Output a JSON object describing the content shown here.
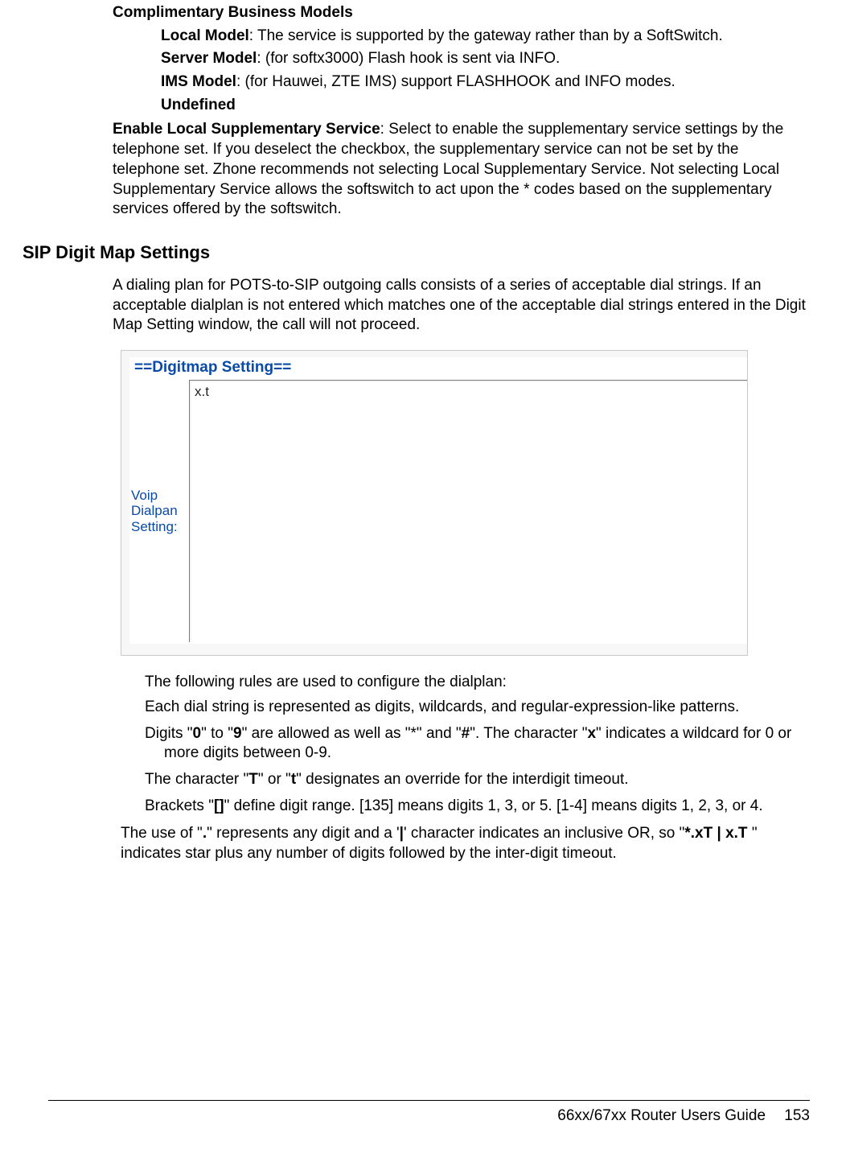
{
  "section1": {
    "heading": "Complimentary Business Models",
    "items": [
      {
        "label": "Local Model",
        "desc": ": The service is supported by the gateway rather than by a SoftSwitch."
      },
      {
        "label": "Server Model",
        "desc": ": (for softx3000) Flash hook is sent via INFO."
      },
      {
        "label": "IMS Model",
        "desc": ": (for Hauwei, ZTE IMS) support FLASHHOOK and INFO modes."
      },
      {
        "label": "Undefined",
        "desc": ""
      }
    ],
    "enable": {
      "label": "Enable Local Supplementary Service",
      "desc": ": Select to enable the supplementary service settings by the telephone set. If you deselect the checkbox, the supplementary service can not be set by the telephone set. Zhone recommends not selecting Local Supplementary Service. Not selecting Local Supplementary Service allows the softswitch to act upon the * codes based on the supplementary services offered by the softswitch."
    }
  },
  "section2": {
    "heading": "SIP Digit Map Settings",
    "intro": "A dialing plan for POTS-to-SIP outgoing calls consists of a series of acceptable dial strings. If an acceptable dialplan is not entered which matches one of the acceptable dial strings entered in the Digit Map Setting window, the call will not proceed.",
    "screenshot": {
      "title": "==Digitmap Setting==",
      "label_line1": "Voip",
      "label_line2": "Dialpan",
      "label_line3": "Setting:",
      "textarea_value": "x.t"
    },
    "rules_intro": "The following rules are used to configure the dialplan:",
    "rules": {
      "r1": "Each dial string is represented as digits, wildcards, and regular-expression-like patterns.",
      "r2_pre": "Digits \"",
      "r2_b1": "0",
      "r2_mid1": "\" to \"",
      "r2_b2": "9",
      "r2_mid2": "\" are allowed as well as \"*\" and \"",
      "r2_b3": "#",
      "r2_mid3": "\". The character \"",
      "r2_b4": "x",
      "r2_post": "\" indicates a wildcard for 0 or more digits between 0-9.",
      "r3_pre": "The character \"",
      "r3_b1": "T",
      "r3_mid": "\" or \"",
      "r3_b2": "t",
      "r3_post": "\" designates an override for the interdigit timeout.",
      "r4_pre": "Brackets \"",
      "r4_b1": "[]",
      "r4_post": "\" define digit range. [135] means digits 1, 3, or 5. [1-4] means digits 1, 2, 3, or 4."
    },
    "closing_pre": "The use of \"",
    "closing_b1": ".",
    "closing_mid1": "\" represents any digit and a '",
    "closing_b2": "|",
    "closing_mid2": "' character indicates an inclusive OR, so \"",
    "closing_b3": "*.xT | x.T ",
    "closing_post": "\" indicates star plus any number of digits followed by the inter-digit timeout."
  },
  "footer": {
    "title": "66xx/67xx Router Users Guide",
    "page": "153"
  }
}
